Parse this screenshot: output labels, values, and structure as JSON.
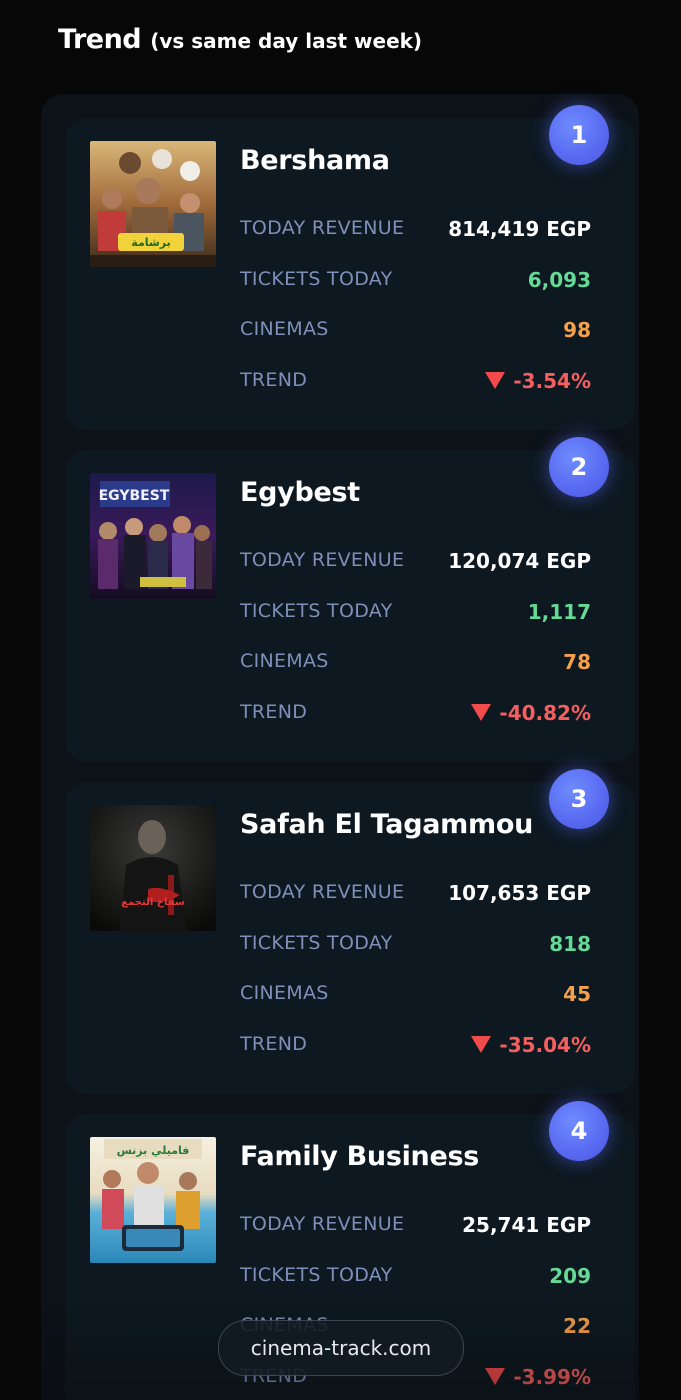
{
  "heading": {
    "main": "Trend",
    "sub": "(vs same day last week)"
  },
  "labels": {
    "revenue": "TODAY REVENUE",
    "tickets": "TICKETS TODAY",
    "cinemas": "CINEMAS",
    "trend": "TREND"
  },
  "movies": [
    {
      "rank": "1",
      "title": "Bershama",
      "revenue": "814,419 EGP",
      "tickets": "6,093",
      "cinemas": "98",
      "trend": "-3.54%",
      "poster_text": "برشامة"
    },
    {
      "rank": "2",
      "title": "Egybest",
      "revenue": "120,074 EGP",
      "tickets": "1,117",
      "cinemas": "78",
      "trend": "-40.82%",
      "poster_text": "EGYBEST"
    },
    {
      "rank": "3",
      "title": "Safah El Tagammou",
      "revenue": "107,653 EGP",
      "tickets": "818",
      "cinemas": "45",
      "trend": "-35.04%",
      "poster_text": "سفاح التجمع"
    },
    {
      "rank": "4",
      "title": "Family Business",
      "revenue": "25,741 EGP",
      "tickets": "209",
      "cinemas": "22",
      "trend": "-3.99%",
      "poster_text": "فاميلي بزنس"
    }
  ],
  "watermark": "cinema-track.com",
  "colors": {
    "background": "#080707",
    "card": "#0d1820",
    "label": "#7f8fba",
    "tickets": "#65d996",
    "cinemas": "#f5a04a",
    "trend_down": "#f55f5f",
    "rank_badge": "#5a6cf2"
  },
  "icons": {
    "trend_down": "down-triangle-icon"
  }
}
